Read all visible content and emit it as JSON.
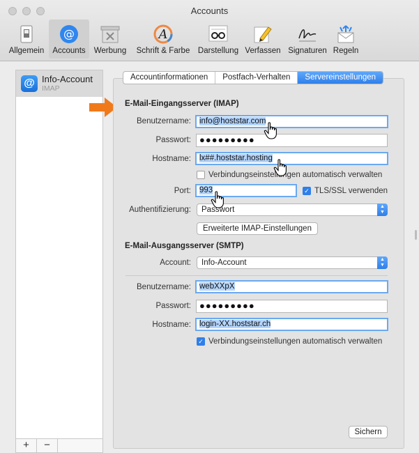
{
  "window": {
    "title": "Accounts"
  },
  "toolbar": {
    "items": [
      {
        "label": "Allgemein",
        "icon": "switch-icon"
      },
      {
        "label": "Accounts",
        "icon": "at-icon"
      },
      {
        "label": "Werbung",
        "icon": "junk-mail-icon"
      },
      {
        "label": "Schrift & Farbe",
        "icon": "font-color-icon"
      },
      {
        "label": "Darstellung",
        "icon": "glasses-icon"
      },
      {
        "label": "Verfassen",
        "icon": "pencil-icon"
      },
      {
        "label": "Signaturen",
        "icon": "signature-icon"
      },
      {
        "label": "Regeln",
        "icon": "rules-icon"
      }
    ],
    "active_index": 1
  },
  "sidebar": {
    "account_name": "Info-Account",
    "account_type": "IMAP",
    "add_label": "+",
    "remove_label": "−"
  },
  "tabs": [
    {
      "label": "Accountinformationen"
    },
    {
      "label": "Postfach-Verhalten"
    },
    {
      "label": "Servereinstellungen"
    }
  ],
  "incoming": {
    "title": "E-Mail-Eingangsserver (IMAP)",
    "username_label": "Benutzername:",
    "username_value": "info@hoststar.com",
    "password_label": "Passwort:",
    "password_value": "●●●●●●●●●",
    "hostname_label": "Hostname:",
    "hostname_value": "lx##.hoststar.hosting",
    "auto_manage_label": "Verbindungseinstellungen automatisch verwalten",
    "port_label": "Port:",
    "port_value": "993",
    "ssl_label": "TLS/SSL verwenden",
    "auth_label": "Authentifizierung:",
    "auth_value": "Passwort",
    "advanced_button": "Erweiterte IMAP-Einstellungen"
  },
  "outgoing": {
    "title": "E-Mail-Ausgangsserver (SMTP)",
    "account_label": "Account:",
    "account_value": "Info-Account",
    "username_label": "Benutzername:",
    "username_value": "webXXpX",
    "password_label": "Passwort:",
    "password_value": "●●●●●●●●●",
    "hostname_label": "Hostname:",
    "hostname_value": "login-XX.hoststar.ch",
    "auto_manage_label": "Verbindungseinstellungen automatisch verwalten"
  },
  "save_button": "Sichern",
  "colors": {
    "accent": "#2f7fe9",
    "arrow": "#f07a1a",
    "selection": "#b3d4fc"
  }
}
